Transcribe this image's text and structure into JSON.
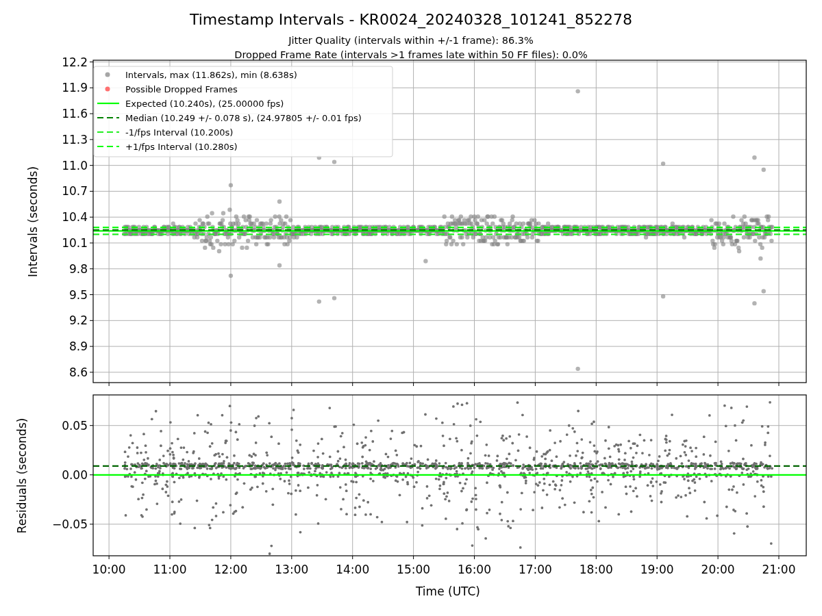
{
  "figure": {
    "title": "Timestamp Intervals - KR0024_20240328_101241_852278",
    "subtitles": [
      "Jitter Quality (intervals within +/-1 frame): 86.3%",
      "Dropped Frame Rate (intervals >1 frames late within 50 FF files): 0.0%"
    ]
  },
  "intervals_plot": {
    "legend_markers": [
      {
        "label": "Intervals, max (11.862s), min (8.638s)",
        "color": "#a6a6a6"
      },
      {
        "label": "Possible Dropped Frames",
        "color": "#ff7070"
      }
    ],
    "chart_data": {
      "type": "line",
      "ylabel": "Intervals (seconds)",
      "x": [
        9.74,
        21.45
      ],
      "xlim": [
        9.74,
        21.45
      ],
      "ylim": [
        8.48,
        12.22
      ],
      "grid": true,
      "legend": "upper left",
      "series": [
        {
          "name": "Expected (10.240s), (25.00000 fps)",
          "color": "#00ff00",
          "line_style": "solid",
          "values": [
            10.24,
            10.24
          ]
        },
        {
          "name": "Median (10.249 +/- 0.078 s), (24.97805 +/- 0.01 fps)",
          "color": "#008000",
          "line_style": "dashed",
          "values": [
            10.249,
            10.249
          ]
        },
        {
          "name": "-1/fps Interval (10.200s)",
          "color": "#22ee22",
          "line_style": "dashed",
          "values": [
            10.2,
            10.2
          ]
        },
        {
          "name": "+1/fps Interval (10.280s)",
          "color": "#00ff00",
          "line_style": "dashed",
          "values": [
            10.28,
            10.28
          ]
        }
      ],
      "yticks": [
        {
          "value": 8.6,
          "label": "8.6"
        },
        {
          "value": 8.9,
          "label": "8.9"
        },
        {
          "value": 9.2,
          "label": "9.2"
        },
        {
          "value": 9.5,
          "label": "9.5"
        },
        {
          "value": 9.8,
          "label": "9.8"
        },
        {
          "value": 10.1,
          "label": "10.1"
        },
        {
          "value": 10.4,
          "label": "10.4"
        },
        {
          "value": 10.7,
          "label": "10.7"
        },
        {
          "value": 11.0,
          "label": "11.0"
        },
        {
          "value": 11.3,
          "label": "11.3"
        },
        {
          "value": 11.6,
          "label": "11.6"
        },
        {
          "value": 11.9,
          "label": "11.9"
        },
        {
          "value": 12.2,
          "label": "12.2"
        }
      ]
    }
  },
  "residuals_plot": {
    "chart_data": {
      "type": "line",
      "ylabel": "Residuals (seconds)",
      "xlabel": "Time (UTC)",
      "x": [
        9.74,
        21.45
      ],
      "xlim": [
        9.74,
        21.45
      ],
      "ylim": [
        -0.082,
        0.081
      ],
      "grid": true,
      "series": [
        {
          "color": "#00ff00",
          "line_style": "solid",
          "values": [
            0,
            0
          ]
        },
        {
          "color": "#006400",
          "line_style": "dashed",
          "values": [
            0.009,
            0.009
          ]
        }
      ],
      "xticks": [
        {
          "value": 10,
          "label": "10:00"
        },
        {
          "value": 11,
          "label": "11:00"
        },
        {
          "value": 12,
          "label": "12:00"
        },
        {
          "value": 13,
          "label": "13:00"
        },
        {
          "value": 14,
          "label": "14:00"
        },
        {
          "value": 15,
          "label": "15:00"
        },
        {
          "value": 16,
          "label": "16:00"
        },
        {
          "value": 17,
          "label": "17:00"
        },
        {
          "value": 18,
          "label": "18:00"
        },
        {
          "value": 19,
          "label": "19:00"
        },
        {
          "value": 20,
          "label": "20:00"
        },
        {
          "value": 21,
          "label": "21:00"
        }
      ],
      "yticks": [
        {
          "value": -0.05,
          "label": "−0.05"
        },
        {
          "value": 0,
          "label": "0.00"
        },
        {
          "value": 0.05,
          "label": "0.05"
        }
      ]
    }
  }
}
